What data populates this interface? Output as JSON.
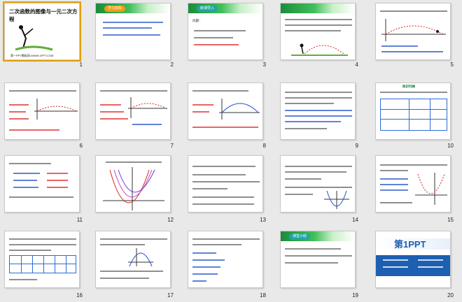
{
  "slides": [
    {
      "n": "1",
      "title": "二次函数的图像与一元二次方程",
      "footer": "第一PPT模板网-WWW.1PPT.COM"
    },
    {
      "n": "2",
      "badge": "学习目标"
    },
    {
      "n": "3",
      "badge": "新课导入",
      "text": "问题："
    },
    {
      "n": "4"
    },
    {
      "n": "5"
    },
    {
      "n": "6"
    },
    {
      "n": "7"
    },
    {
      "n": "8"
    },
    {
      "n": "9"
    },
    {
      "n": "10",
      "heading": "知识归纳"
    },
    {
      "n": "11"
    },
    {
      "n": "12"
    },
    {
      "n": "13"
    },
    {
      "n": "14"
    },
    {
      "n": "15"
    },
    {
      "n": "16"
    },
    {
      "n": "17"
    },
    {
      "n": "18"
    },
    {
      "n": "19",
      "badge": "课堂小结"
    },
    {
      "n": "20",
      "logo": "第1PPT"
    }
  ],
  "colors": {
    "accent": "#2a6dd8",
    "green": "#1b8c3a",
    "orange": "#f29b14",
    "red": "#d22222"
  }
}
